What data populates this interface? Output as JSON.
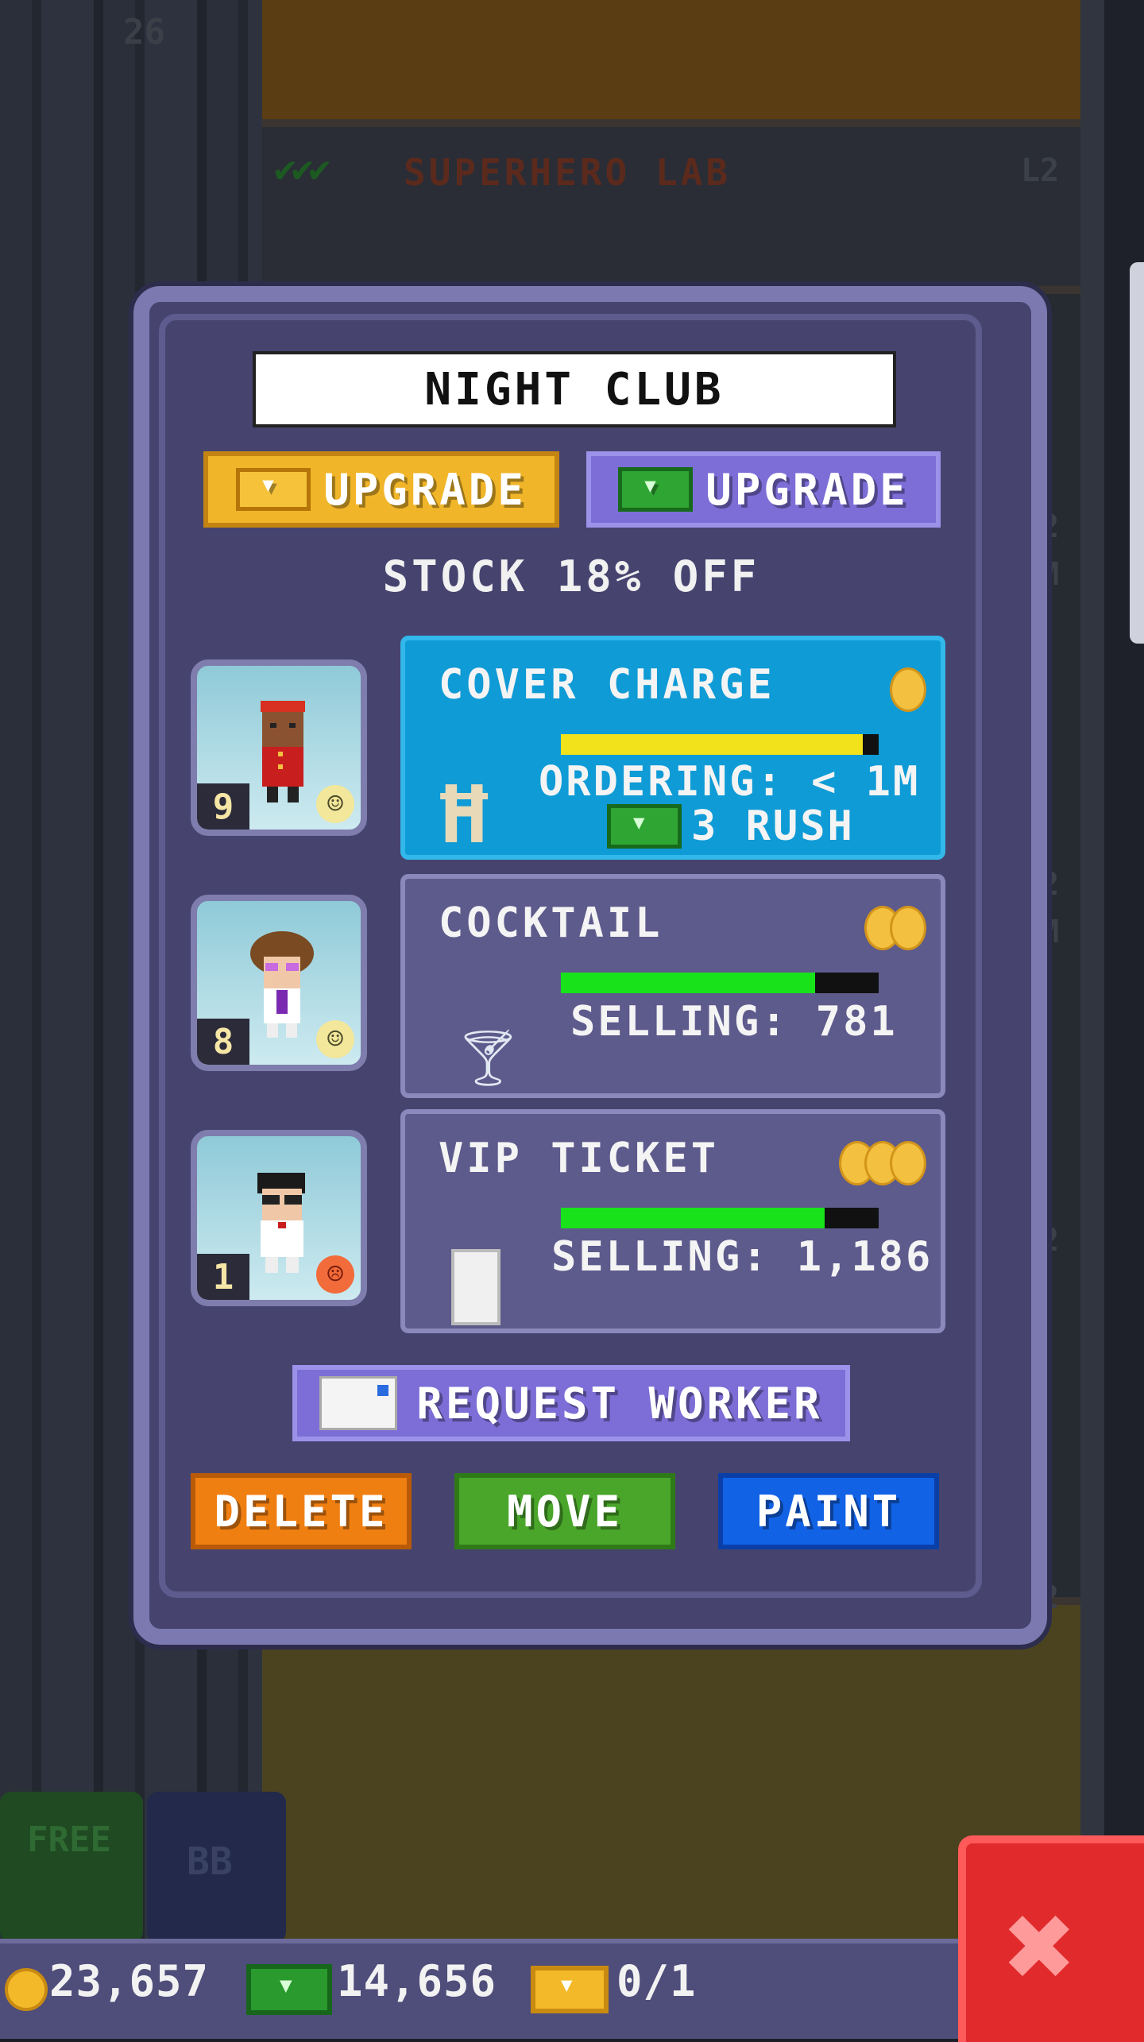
{
  "background": {
    "floor_number": "26",
    "top_floor_name": "SUPERHERO LAB",
    "top_floor_level": "L2",
    "side_levels": [
      "L2",
      "L2",
      "L2",
      "L2",
      "L2"
    ],
    "side_values": [
      "1M",
      "1M"
    ],
    "free_button": "FREE",
    "bb_button": "BB"
  },
  "dialog": {
    "title": "NIGHT CLUB",
    "upgrade_gold_label": "UPGRADE",
    "upgrade_cash_label": "UPGRADE",
    "stock_text": "STOCK 18% OFF",
    "products": [
      {
        "name": "COVER CHARGE",
        "status": "ORDERING: < 1M",
        "rush": "3 RUSH",
        "progress": 0.95,
        "bar_color": "#f2e21c",
        "coin_count": 1,
        "active": true,
        "icon": "velvet-rope-icon"
      },
      {
        "name": "COCKTAIL",
        "status": "SELLING: 781",
        "progress": 0.8,
        "bar_color": "#18e21a",
        "coin_count": 2,
        "active": false,
        "icon": "cocktail-glass-icon"
      },
      {
        "name": "VIP TICKET",
        "status": "SELLING: 1,186",
        "progress": 0.83,
        "bar_color": "#18e21a",
        "coin_count": 3,
        "active": false,
        "icon": "vip-ticket-icon"
      }
    ],
    "workers": [
      {
        "level": "9",
        "mood": "happy"
      },
      {
        "level": "8",
        "mood": "happy"
      },
      {
        "level": "1",
        "mood": "unhappy"
      }
    ],
    "request_worker_label": "REQUEST WORKER",
    "delete_label": "DELETE",
    "move_label": "MOVE",
    "paint_label": "PAINT"
  },
  "statusbar": {
    "coins": "23,657",
    "bux": "14,656",
    "tickets": "0/1"
  },
  "colors": {
    "dialog_bg": "#46446f",
    "gold_button": "#f0b528",
    "purple_button": "#7c6ed6",
    "active_card": "#0f9bd6",
    "delete": "#f07f12",
    "move": "#4aa62a",
    "paint": "#1262e6",
    "close": "#e02a2c"
  }
}
